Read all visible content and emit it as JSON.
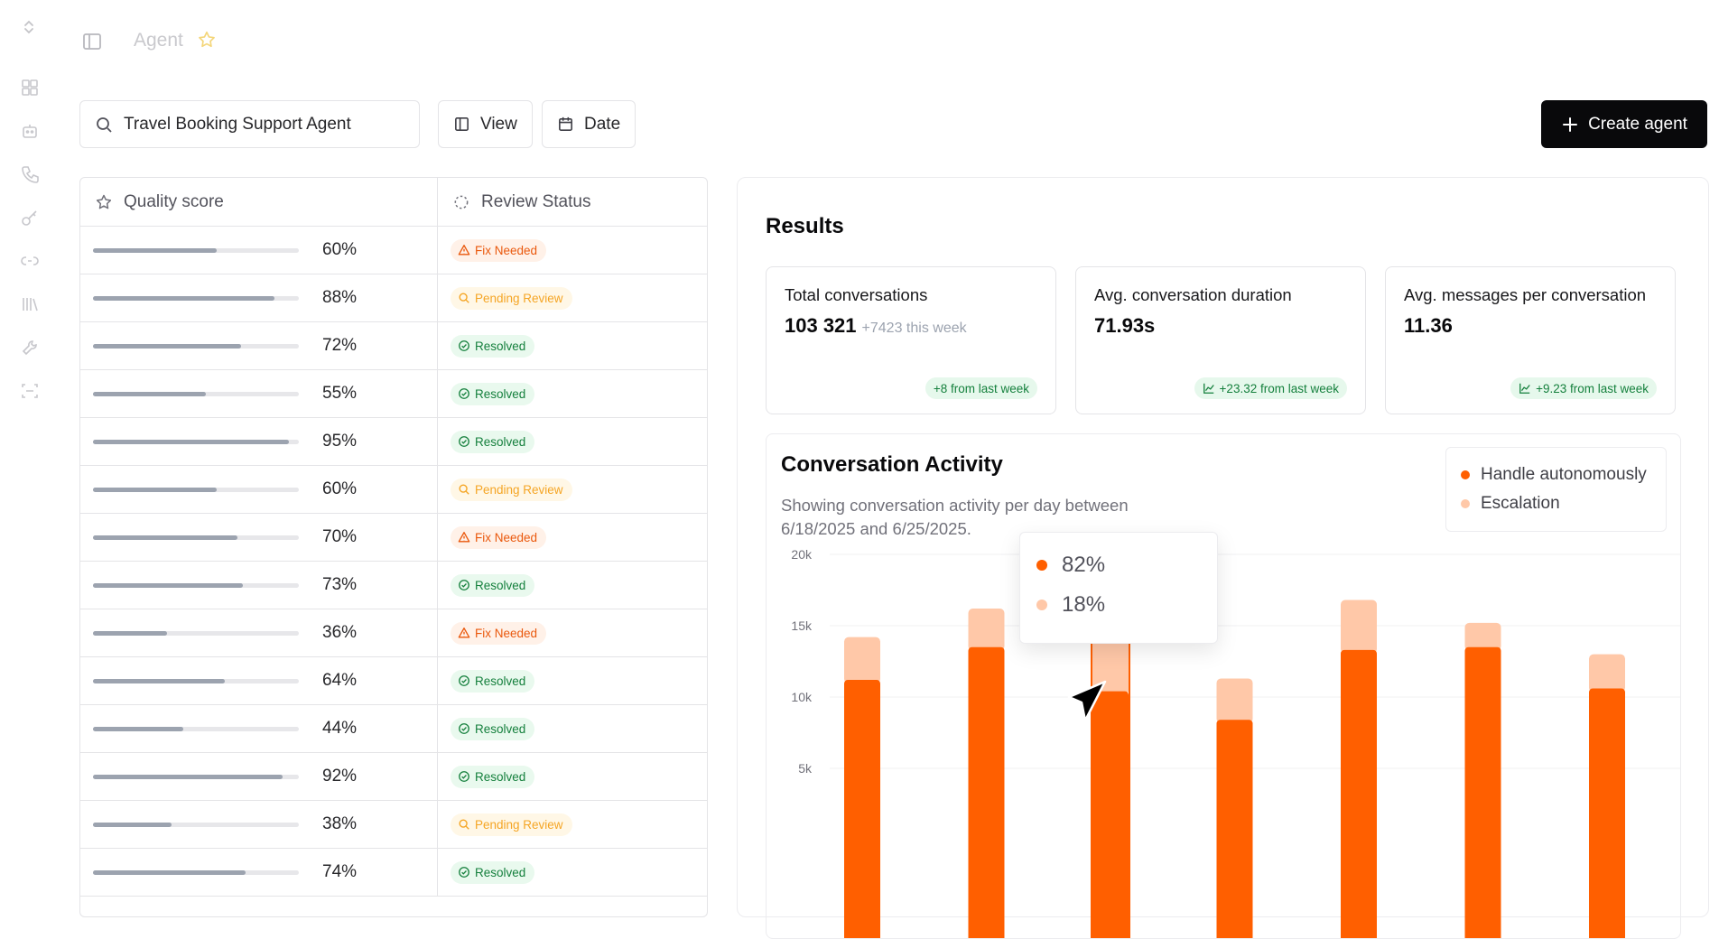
{
  "header": {
    "title": "Agent"
  },
  "toolbar": {
    "search_value": "Travel Booking Support Agent",
    "view_label": "View",
    "date_label": "Date",
    "create_label": "Create agent"
  },
  "table": {
    "columns": [
      "Quality score",
      "Review Status"
    ],
    "rows": [
      {
        "score": 60,
        "score_label": "60%",
        "status": "Fix Needed"
      },
      {
        "score": 88,
        "score_label": "88%",
        "status": "Pending Review"
      },
      {
        "score": 72,
        "score_label": "72%",
        "status": "Resolved"
      },
      {
        "score": 55,
        "score_label": "55%",
        "status": "Resolved"
      },
      {
        "score": 95,
        "score_label": "95%",
        "status": "Resolved"
      },
      {
        "score": 60,
        "score_label": "60%",
        "status": "Pending Review"
      },
      {
        "score": 70,
        "score_label": "70%",
        "status": "Fix Needed"
      },
      {
        "score": 73,
        "score_label": "73%",
        "status": "Resolved"
      },
      {
        "score": 36,
        "score_label": "36%",
        "status": "Fix Needed"
      },
      {
        "score": 64,
        "score_label": "64%",
        "status": "Resolved"
      },
      {
        "score": 44,
        "score_label": "44%",
        "status": "Resolved"
      },
      {
        "score": 92,
        "score_label": "92%",
        "status": "Resolved"
      },
      {
        "score": 38,
        "score_label": "38%",
        "status": "Pending Review"
      },
      {
        "score": 74,
        "score_label": "74%",
        "status": "Resolved"
      }
    ]
  },
  "results": {
    "title": "Results",
    "stats": [
      {
        "label": "Total conversations",
        "value": "103 321",
        "sub": "+7423 this week",
        "delta": "+8 from last week",
        "delta_icon": false
      },
      {
        "label": "Avg. conversation duration",
        "value": "71.93s",
        "sub": "",
        "delta": "+23.32 from last week",
        "delta_icon": true
      },
      {
        "label": "Avg. messages per conversation",
        "value": "11.36",
        "sub": "",
        "delta": "+9.23 from last week",
        "delta_icon": true
      }
    ]
  },
  "activity": {
    "title": "Conversation Activity",
    "description": "Showing conversation activity per day between 6/18/2025 and 6/25/2025.",
    "legend": [
      {
        "label": "Handle autonomously",
        "color": "#ff5f00"
      },
      {
        "label": "Escalation",
        "color": "#ffc8a8"
      }
    ],
    "tooltip": [
      "82%",
      "18%"
    ]
  },
  "chart_data": {
    "type": "bar",
    "stacked": true,
    "y_ticks": [
      "20k",
      "15k",
      "10k",
      "5k"
    ],
    "ylim": [
      0,
      20000
    ],
    "series": [
      {
        "name": "Handle autonomously",
        "values": [
          11200,
          13500,
          10400,
          8400,
          13300,
          13500,
          10600
        ]
      },
      {
        "name": "Escalation",
        "values": [
          3000,
          2700,
          3700,
          2900,
          3500,
          1700,
          2400
        ]
      }
    ],
    "highlight_index": 2,
    "colors": {
      "primary": "#ff5f00",
      "secondary": "#ffc8a8"
    }
  }
}
